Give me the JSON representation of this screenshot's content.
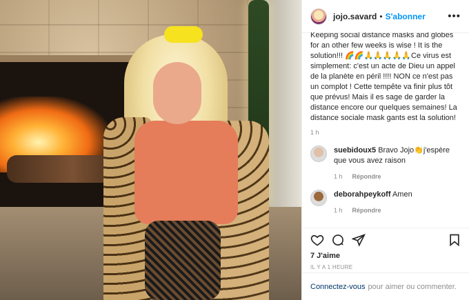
{
  "post": {
    "username": "jojo.savard",
    "dot": "•",
    "follow_label": "S'abonner",
    "more_icon": "more-horizontal-icon",
    "caption": "Keeping social distance masks and globes for an other few weeks is wise ! It is the solution!!! 🌈🌈🙏🙏🙏🙏🙏Ce virus est simplement: c'est un acte de Dieu un appel de la planète en péril !!!! NON ce n'est pas un complot ! Cette tempête va finir plus tôt que prévus! Mais il es sage de garder la distance encore our quelques semaines! La distance sociale mask gants est la solution!",
    "caption_time": "1 h"
  },
  "comments": [
    {
      "username": "suebidoux5",
      "text": "Bravo Jojo👏j'espère que vous avez raison",
      "time": "1 h",
      "reply_label": "Répondre"
    },
    {
      "username": "deborahpeykoff",
      "text": "Amen",
      "time": "1 h",
      "reply_label": "Répondre"
    }
  ],
  "actions": {
    "icons": [
      "heart-icon",
      "comment-icon",
      "share-icon",
      "bookmark-icon"
    ],
    "likes": "7 J'aime",
    "timestamp": "IL Y A 1 HEURE"
  },
  "login": {
    "link_label": "Connectez-vous",
    "rest": "pour aimer ou commenter."
  },
  "colors": {
    "accent": "#0095f6",
    "text": "#262626",
    "muted": "#8e8e8e"
  }
}
